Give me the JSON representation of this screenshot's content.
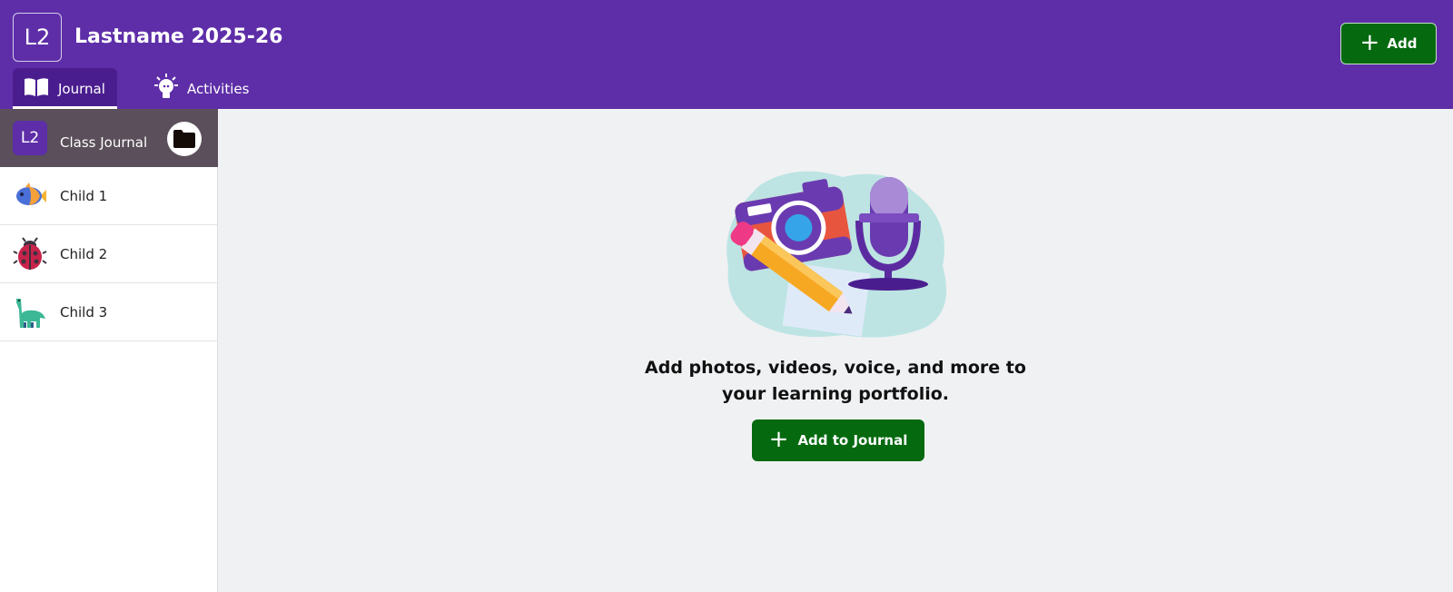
{
  "header": {
    "class_badge": "L2",
    "class_title": "Lastname 2025-26",
    "add_button": "Add",
    "tabs": [
      {
        "label": "Journal",
        "icon": "book-open-icon",
        "active": true
      },
      {
        "label": "Activities",
        "icon": "lightbulb-icon",
        "active": false
      }
    ]
  },
  "sidebar": {
    "items": [
      {
        "label": "Class Journal",
        "avatar_text": "L2",
        "active": true,
        "action_icon": "folder-icon"
      },
      {
        "label": "Child 1",
        "avatar": "fish-avatar-icon"
      },
      {
        "label": "Child 2",
        "avatar": "ladybug-avatar-icon"
      },
      {
        "label": "Child 3",
        "avatar": "dinosaur-avatar-icon"
      }
    ]
  },
  "main": {
    "illustration": "camera-microphone-pencil-illustration",
    "message": "Add photos, videos, voice, and more to your learning portfolio.",
    "add_button": "Add to Journal"
  },
  "colors": {
    "header": "#5e2ea8",
    "active_tab": "#4a1d8f",
    "sidebar_active": "#5a4f5a",
    "primary_button": "#04690f",
    "background": "#f0f1f3"
  }
}
